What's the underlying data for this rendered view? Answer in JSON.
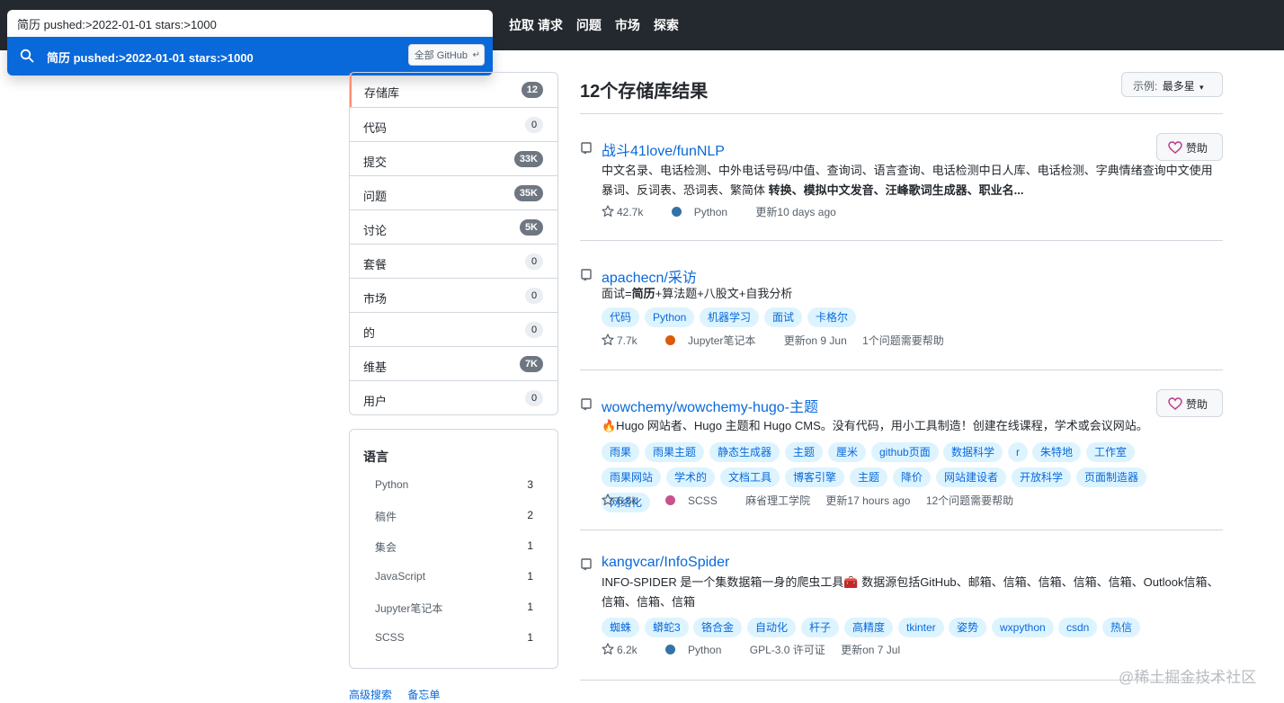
{
  "search": {
    "query": "简历 pushed:>2022-01-01 stars:>1000",
    "suggestion": "简历 pushed:>2022-01-01 stars:>1000",
    "scope": "全部 GitHub",
    "scope_return": "↵"
  },
  "nav": [
    "拉取 请求",
    "问题",
    "市场",
    "探索"
  ],
  "filters": [
    {
      "label": "存储库",
      "count": "12",
      "dark": true
    },
    {
      "label": "代码",
      "count": "0",
      "dark": false
    },
    {
      "label": "提交",
      "count": "33K",
      "dark": true
    },
    {
      "label": "问题",
      "count": "35K",
      "dark": true
    },
    {
      "label": "讨论",
      "count": "5K",
      "dark": true
    },
    {
      "label": "套餐",
      "count": "0",
      "dark": false
    },
    {
      "label": "市场",
      "count": "0",
      "dark": false
    },
    {
      "label": "的",
      "count": "0",
      "dark": false
    },
    {
      "label": "维基",
      "count": "7K",
      "dark": true
    },
    {
      "label": "用户",
      "count": "0",
      "dark": false
    }
  ],
  "languages": {
    "title": "语言",
    "items": [
      {
        "name": "Python",
        "count": "3"
      },
      {
        "name": "稿件",
        "count": "2"
      },
      {
        "name": "集会",
        "count": "1"
      },
      {
        "name": "JavaScript",
        "count": "1"
      },
      {
        "name": "Jupyter笔记本",
        "count": "1"
      },
      {
        "name": "SCSS",
        "count": "1"
      }
    ]
  },
  "bottom_links": [
    "高级搜索",
    "备忘单"
  ],
  "results": {
    "title": "12个存储库结果",
    "sort_label": "示例:",
    "sort_value": "最多星",
    "sort_caret": "▾"
  },
  "sponsor_label": "赞助",
  "repos": [
    {
      "name": "战斗41love/funNLP",
      "desc_plain": "中文名录、电话检测、中外电话号码/中值、查询词、语言查询、电话检测中日人库、电话检测、字典情绪查询中文使用暴词、反词表、恐词表、繁简体 ",
      "desc_bold": "转换、模拟中文发音、汪峰歌词生成器、职业名...",
      "sponsor": true,
      "topics": [],
      "stars": "42.7k",
      "language": "Python",
      "lang_color": "#3572a5",
      "license": "",
      "updated": "更新10 days ago",
      "issues": ""
    },
    {
      "name": "apachecn/采访",
      "desc_pre": "面试=",
      "desc_bold": "简历",
      "desc_post": "+算法题+八股文+自我分析",
      "sponsor": false,
      "topics": [
        "代码",
        "Python",
        "机器学习",
        "面试",
        "卡格尔"
      ],
      "stars": "7.7k",
      "language": "Jupyter笔记本",
      "lang_color": "#da5b0b",
      "license": "",
      "updated": "更新on 9 Jun",
      "issues": "1个问题需要帮助"
    },
    {
      "name": "wowchemy/wowchemy-hugo-主题",
      "desc_plain": "🔥Hugo 网站者、Hugo 主题和 Hugo CMS。没有代码，用小工具制造！创建在线课程，学术或会议网站。",
      "sponsor": true,
      "topics": [
        "雨果",
        "雨果主题",
        "静态生成器",
        "主题",
        "厘米",
        "github页面",
        "数据科学",
        "r",
        "朱特地",
        "工作室",
        "雨果网站",
        "学术的",
        "文档工具",
        "博客引擎",
        "主题",
        "降价",
        "网站建设者",
        "开放科学",
        "页面制造器",
        "网络化"
      ],
      "stars": "6.6k",
      "language": "SCSS",
      "lang_color": "#c6538c",
      "license": "麻省理工学院",
      "updated": "更新17 hours ago",
      "issues": "12个问题需要帮助"
    },
    {
      "name": "kangvcar/InfoSpider",
      "desc_plain": "INFO-SPIDER 是一个集数据箱一身的爬虫工具🧰 数据源包括GitHub、邮箱、信箱、信箱、信箱、信箱、Outlook信箱、信箱、信箱、信箱",
      "sponsor": false,
      "topics": [
        "蜘蛛",
        "蟒蛇3",
        "铬合金",
        "自动化",
        "杆子",
        "高精度",
        "tkinter",
        "姿势",
        "wxpython",
        "csdn",
        "热信"
      ],
      "stars": "6.2k",
      "language": "Python",
      "lang_color": "#3572a5",
      "license": "GPL-3.0 许可证",
      "updated": "更新on 7 Jul",
      "issues": ""
    }
  ],
  "watermark": "@稀土掘金技术社区"
}
